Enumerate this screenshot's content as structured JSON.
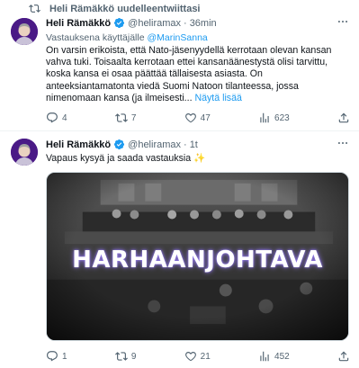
{
  "tweet1": {
    "retweet_label": "Heli Rämäkkö uudelleentwiittasi",
    "author_name": "Heli Rämäkkö",
    "handle": "@heliramax",
    "separator": "·",
    "time": "36min",
    "reply_prefix": "Vastauksena käyttäjälle",
    "reply_mention": "@MarinSanna",
    "body": "On varsin erikoista, että Nato-jäsenyydellä kerrotaan olevan kansan vahva tuki. Toisaalta kerrotaan ettei kansanäänestystä olisi tarvittu, koska kansa ei osaa päättää tällaisesta asiasta. On anteeksiantamatonta viedä Suomi Natoon tilanteessa, jossa nimenomaan kansa (ja ilmeisesti...",
    "show_more": "Näytä lisää",
    "reply_count": "4",
    "retweet_count": "7",
    "like_count": "47",
    "view_count": "623"
  },
  "tweet2": {
    "author_name": "Heli Rämäkkö",
    "handle": "@heliramax",
    "separator": "·",
    "time": "1t",
    "body": "Vapaus kysyä ja saada vastauksia",
    "emoji": "✨",
    "media_overlay_text": "HARHAANJOHTAVA",
    "reply_count": "1",
    "retweet_count": "9",
    "like_count": "21",
    "view_count": "452"
  },
  "colors": {
    "link_blue": "#1d9bf0",
    "secondary_text": "#536471",
    "verified_blue": "#1d9bf0",
    "avatar_bg": "#4a1a86"
  }
}
